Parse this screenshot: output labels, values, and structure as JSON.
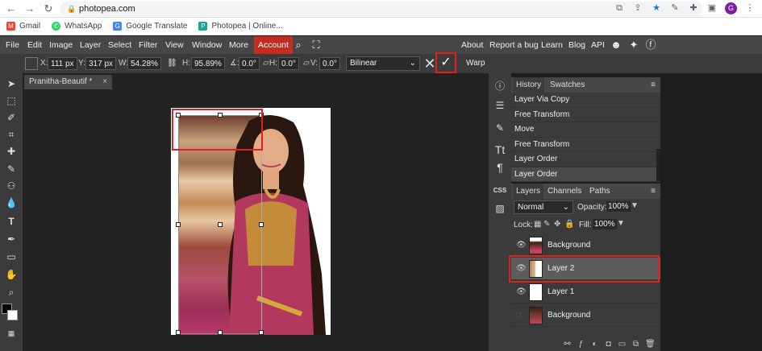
{
  "browser": {
    "url": "photopea.com",
    "bookmarks": [
      {
        "label": "Gmail",
        "color": "#ea4335"
      },
      {
        "label": "WhatsApp",
        "color": "#25d366"
      },
      {
        "label": "Google Translate",
        "color": "#4285f4"
      },
      {
        "label": "Photopea | Online...",
        "color": "#18a497"
      }
    ]
  },
  "menu": {
    "items": [
      "File",
      "Edit",
      "Image",
      "Layer",
      "Select",
      "Filter",
      "View",
      "Window",
      "More"
    ],
    "account": "Account",
    "right_items": [
      "About",
      "Report a bug",
      "Learn",
      "Blog",
      "API"
    ]
  },
  "options": {
    "x_label": "X:",
    "x_value": "111 px",
    "y_label": "Y:",
    "y_value": "317 px",
    "w_label": "W:",
    "w_value": "54.28%",
    "h_label": "H:",
    "h_value": "95.89%",
    "angle_value": "0.0°",
    "hskew_label": "H:",
    "hskew_value": "0.0°",
    "vskew_label": "V:",
    "vskew_value": "0.0°",
    "interpolation": "Bilinear",
    "warp_label": "Warp"
  },
  "document": {
    "tab_title": "Pranitha-Beautif",
    "tab_modified": "*"
  },
  "history": {
    "tabs": [
      "History",
      "Swatches"
    ],
    "items": [
      "Layer Via Copy",
      "Free Transform",
      "Move",
      "Free Transform",
      "Layer Order",
      "Layer Order"
    ]
  },
  "layers_panel": {
    "tabs": [
      "Layers",
      "Channels",
      "Paths"
    ],
    "blend_mode": "Normal",
    "opacity_label": "Opacity:",
    "opacity_value": "100%",
    "lock_label": "Lock:",
    "fill_label": "Fill:",
    "fill_value": "100%",
    "layers": [
      {
        "name": "Background",
        "visible": true,
        "selected": false
      },
      {
        "name": "Layer 2",
        "visible": true,
        "selected": true
      },
      {
        "name": "Layer 1",
        "visible": true,
        "selected": false
      },
      {
        "name": "Background",
        "visible": false,
        "selected": false
      }
    ]
  },
  "colors": {
    "accent_red": "#e41f1f",
    "account_red": "#c42c1f",
    "panel_bg": "#3b3b3b"
  }
}
